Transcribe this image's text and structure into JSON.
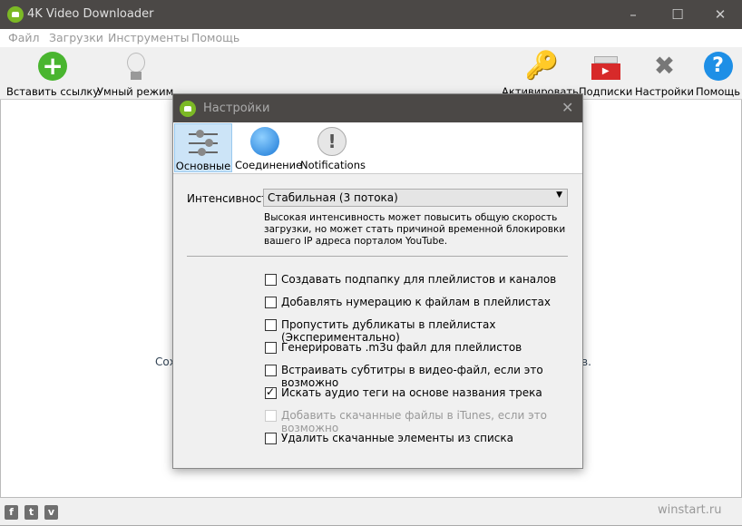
{
  "window": {
    "title": "4K Video Downloader",
    "controls": [
      "minimize",
      "maximize",
      "close"
    ]
  },
  "menu": [
    "Файл",
    "Загрузки",
    "Инструменты",
    "Помощь"
  ],
  "toolbar": {
    "left": [
      {
        "label": "Вставить ссылку",
        "icon": "plus-icon"
      },
      {
        "label": "Умный режим",
        "icon": "lightbulb-icon"
      }
    ],
    "right": [
      {
        "label": "Активировать",
        "icon": "key-icon"
      },
      {
        "label": "Подписки",
        "icon": "subscriptions-icon"
      },
      {
        "label": "Настройки",
        "icon": "tools-icon"
      },
      {
        "label": "Помощь",
        "icon": "help-icon"
      }
    ]
  },
  "background": {
    "text_left": "Сох",
    "text_right": "в."
  },
  "footer": {
    "social": [
      "f",
      "t",
      "v"
    ],
    "watermark": "winstart.ru"
  },
  "dialog": {
    "title": "Настройки",
    "tabs": [
      {
        "label": "Основные",
        "active": true
      },
      {
        "label": "Соединение",
        "active": false
      },
      {
        "label": "Notifications",
        "active": false
      }
    ],
    "intensity": {
      "label": "Интенсивность",
      "value": "Стабильная (3 потока)",
      "hint": "Высокая интенсивность может повысить общую скорость загрузки, но может стать причиной временной блокировки вашего IP адреса порталом YouTube."
    },
    "options": [
      {
        "label": "Создавать подпапку для плейлистов и каналов",
        "checked": false,
        "disabled": false
      },
      {
        "label": "Добавлять нумерацию к файлам в плейлистах",
        "checked": false,
        "disabled": false
      },
      {
        "label": "Пропустить дубликаты в плейлистах (Экспериментально)",
        "checked": false,
        "disabled": false
      },
      {
        "label": "Генерировать .m3u файл для плейлистов",
        "checked": false,
        "disabled": false
      },
      {
        "label": "Встраивать субтитры в видео-файл, если это возможно",
        "checked": false,
        "disabled": false
      },
      {
        "label": "Искать аудио теги на основе названия трека",
        "checked": true,
        "disabled": false
      },
      {
        "label": "Добавить скачанные файлы в iTunes, если это возможно",
        "checked": false,
        "disabled": true
      },
      {
        "label": "Удалить скачанные элементы из списка",
        "checked": false,
        "disabled": false
      }
    ]
  },
  "colors": {
    "titlebar": "#4b4846",
    "accent_green": "#7cb925",
    "active_tab": "#cce4f7"
  }
}
